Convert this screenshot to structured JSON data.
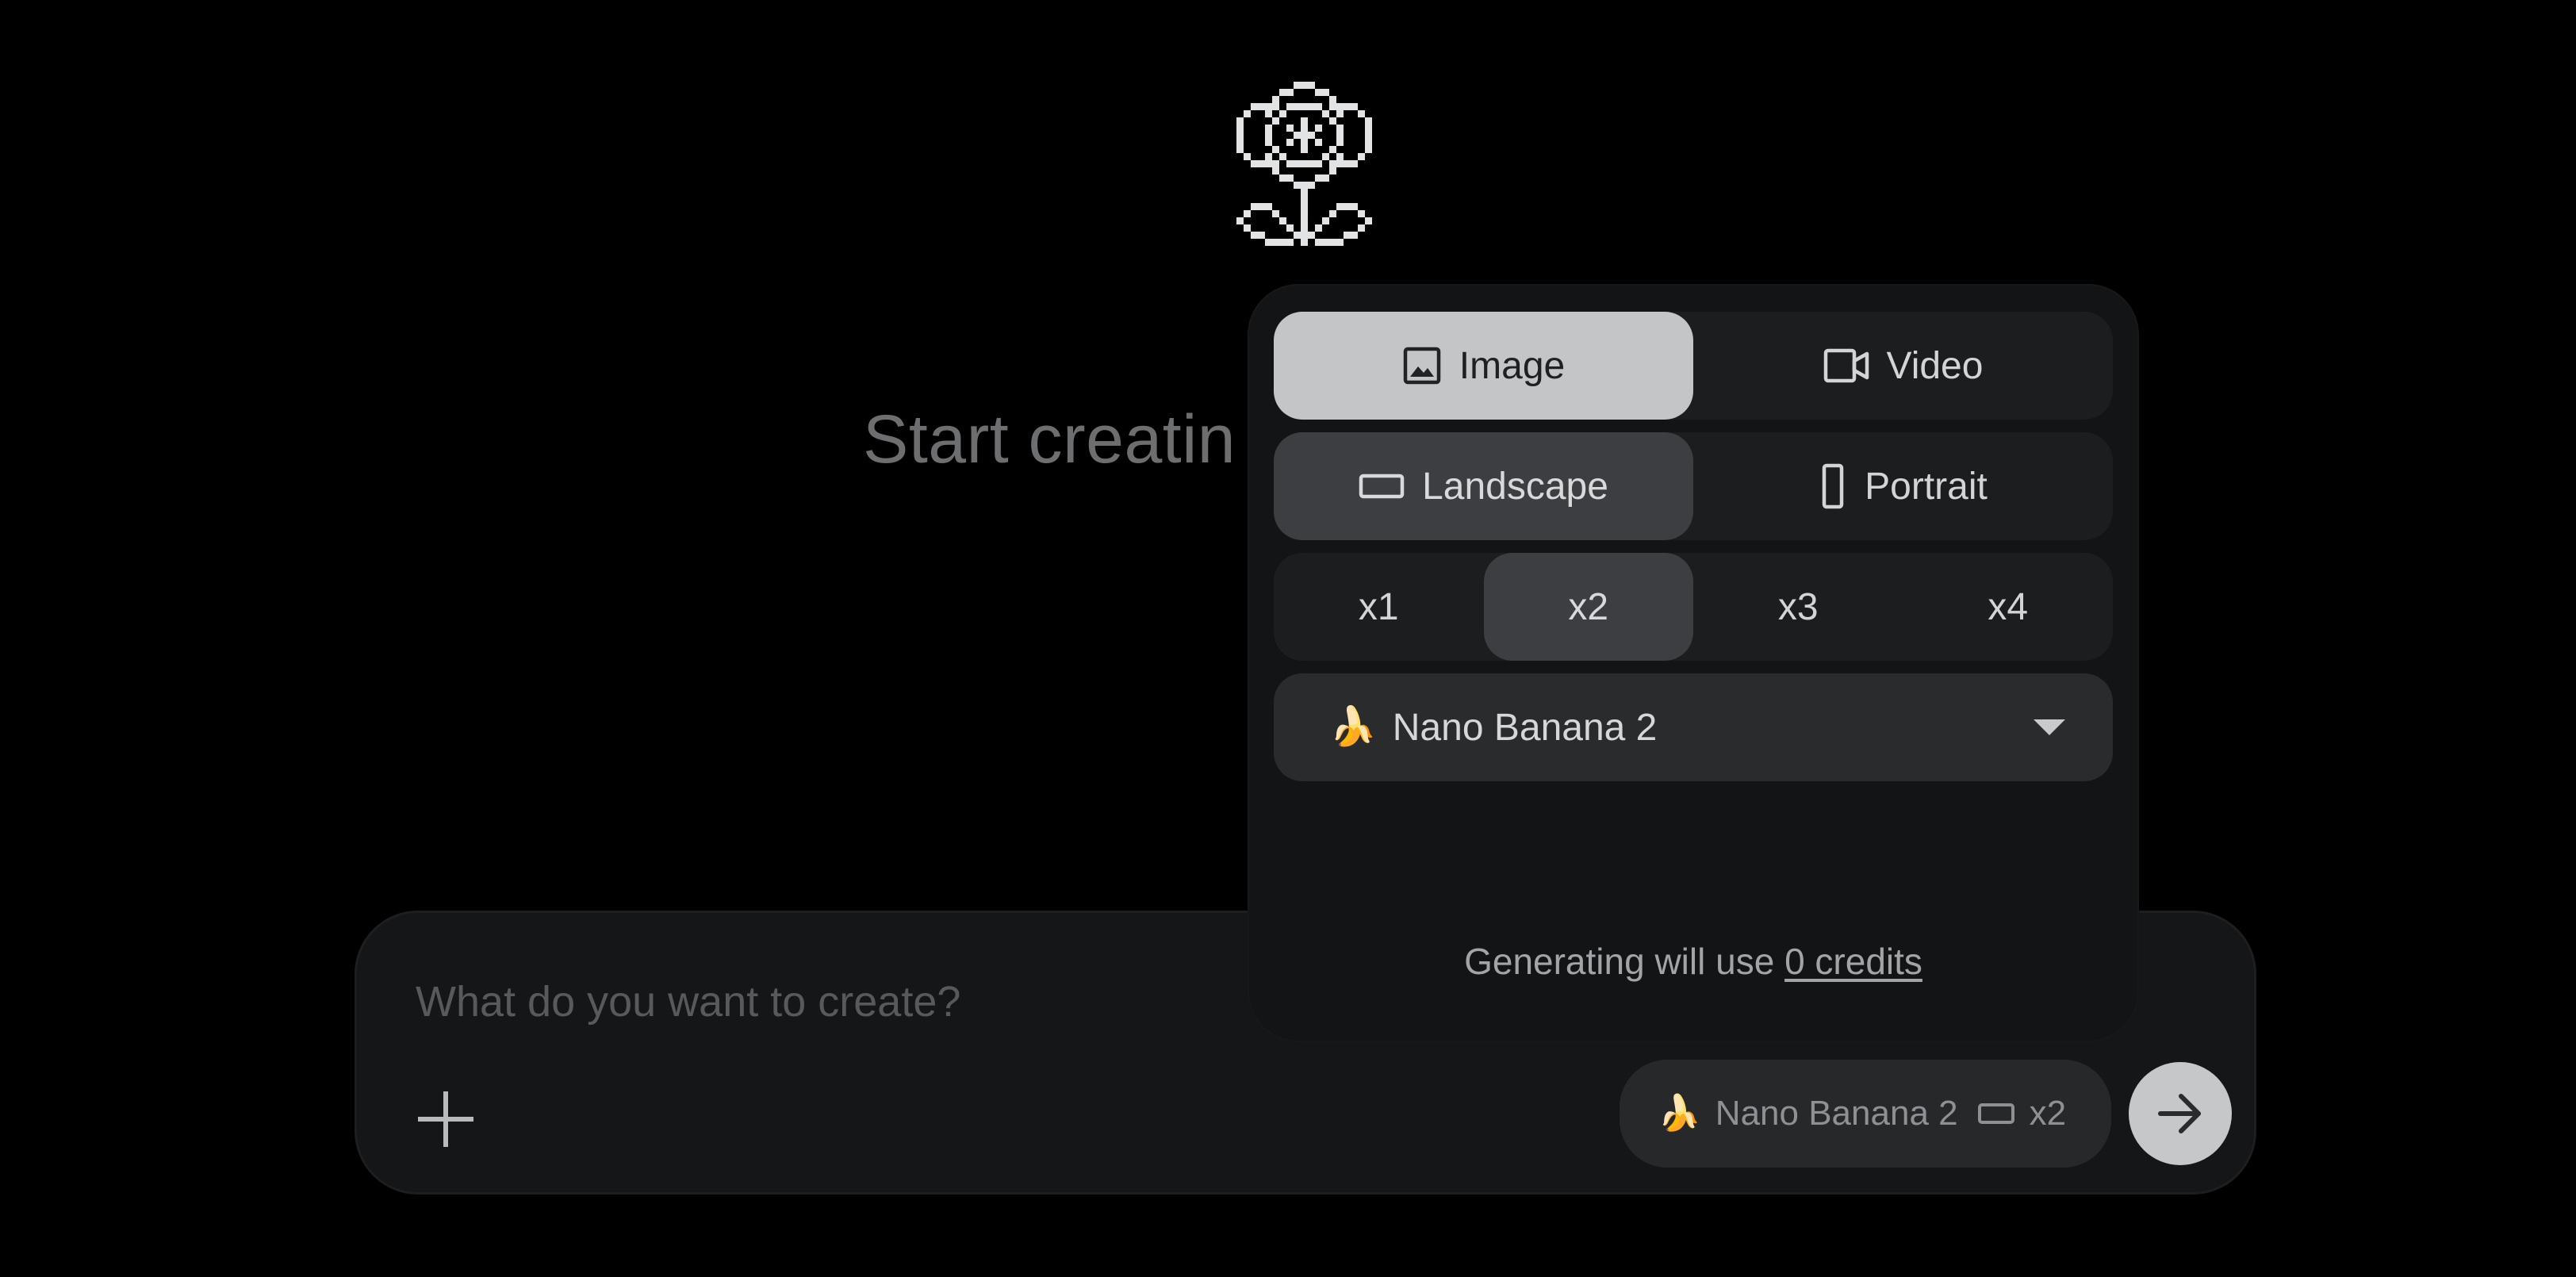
{
  "main": {
    "headline": "Start creatin"
  },
  "composer": {
    "placeholder": "What do you want to create?",
    "add_icon": "plus-icon",
    "send_icon": "arrow-right-icon",
    "chip": {
      "emoji": "🍌",
      "model": "Nano Banana 2",
      "aspect_icon": "landscape-rect-icon",
      "count": "x2"
    }
  },
  "popover": {
    "media_types": [
      {
        "label": "Image",
        "icon": "image-icon",
        "selected": true
      },
      {
        "label": "Video",
        "icon": "video-camera-icon",
        "selected": false
      }
    ],
    "orientations": [
      {
        "label": "Landscape",
        "icon": "landscape-rect-icon",
        "selected": true
      },
      {
        "label": "Portrait",
        "icon": "portrait-rect-icon",
        "selected": false
      }
    ],
    "counts": [
      {
        "label": "x1",
        "selected": false
      },
      {
        "label": "x2",
        "selected": true
      },
      {
        "label": "x3",
        "selected": false
      },
      {
        "label": "x4",
        "selected": false
      }
    ],
    "model": {
      "emoji": "🍌",
      "label": "Nano Banana 2",
      "icon": "caret-down-icon"
    },
    "credits": {
      "prefix": "Generating will use",
      "link": "0 credits"
    }
  },
  "colors": {
    "background": "#000000",
    "panel": "#131415",
    "segment_bg": "#1c1d1f",
    "selected_light": "#c4c5c7",
    "selected_dark": "#3d3e41"
  }
}
